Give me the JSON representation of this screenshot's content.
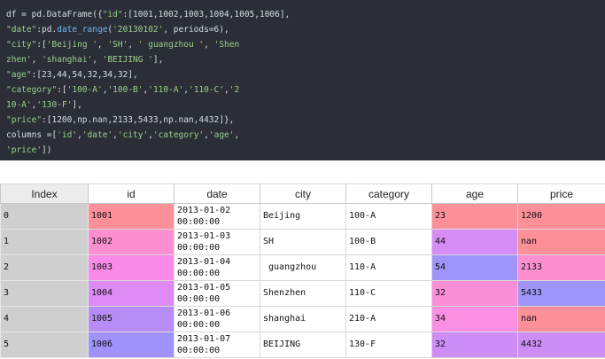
{
  "code": {
    "lines": [
      [
        {
          "t": "df = pd.DataFrame({",
          "c": ""
        },
        {
          "t": "\"id\"",
          "c": "str"
        },
        {
          "t": ":[1001,1002,1003,1004,1005,1006],",
          "c": ""
        }
      ],
      [
        {
          "t": "\"date\"",
          "c": "str"
        },
        {
          "t": ":pd.",
          "c": ""
        },
        {
          "t": "date_range",
          "c": "fn"
        },
        {
          "t": "(",
          "c": ""
        },
        {
          "t": "'20130102'",
          "c": "str"
        },
        {
          "t": ", periods=6),",
          "c": ""
        }
      ],
      [
        {
          "t": "\"city\"",
          "c": "str"
        },
        {
          "t": ":[",
          "c": ""
        },
        {
          "t": "'Beijing '",
          "c": "str"
        },
        {
          "t": ", ",
          "c": ""
        },
        {
          "t": "'SH'",
          "c": "str"
        },
        {
          "t": ", ",
          "c": ""
        },
        {
          "t": "' guangzhou '",
          "c": "str"
        },
        {
          "t": ", ",
          "c": ""
        },
        {
          "t": "'Shen",
          "c": "str"
        }
      ],
      [
        {
          "t": "zhen'",
          "c": "str"
        },
        {
          "t": ", ",
          "c": ""
        },
        {
          "t": "'shanghai'",
          "c": "str"
        },
        {
          "t": ", ",
          "c": ""
        },
        {
          "t": "'BEIJING '",
          "c": "str"
        },
        {
          "t": "],",
          "c": ""
        }
      ],
      [
        {
          "t": "\"age\"",
          "c": "str"
        },
        {
          "t": ":[23,44,54,32,34,32],",
          "c": ""
        }
      ],
      [
        {
          "t": "\"category\"",
          "c": "str"
        },
        {
          "t": ":[",
          "c": ""
        },
        {
          "t": "'100-A'",
          "c": "str"
        },
        {
          "t": ",",
          "c": ""
        },
        {
          "t": "'100-B'",
          "c": "str"
        },
        {
          "t": ",",
          "c": ""
        },
        {
          "t": "'110-A'",
          "c": "str"
        },
        {
          "t": ",",
          "c": ""
        },
        {
          "t": "'110-C'",
          "c": "str"
        },
        {
          "t": ",",
          "c": ""
        },
        {
          "t": "'2",
          "c": "str"
        }
      ],
      [
        {
          "t": "10-A'",
          "c": "str"
        },
        {
          "t": ",",
          "c": ""
        },
        {
          "t": "'130-F'",
          "c": "str"
        },
        {
          "t": "],",
          "c": ""
        }
      ],
      [
        {
          "t": "\"price\"",
          "c": "str"
        },
        {
          "t": ":[1200,np.nan,2133,5433,np.nan,4432]},",
          "c": ""
        }
      ],
      [
        {
          "t": "columns =[",
          "c": ""
        },
        {
          "t": "'id'",
          "c": "str"
        },
        {
          "t": ",",
          "c": ""
        },
        {
          "t": "'date'",
          "c": "str"
        },
        {
          "t": ",",
          "c": ""
        },
        {
          "t": "'city'",
          "c": "str"
        },
        {
          "t": ",",
          "c": ""
        },
        {
          "t": "'category'",
          "c": "str"
        },
        {
          "t": ",",
          "c": ""
        },
        {
          "t": "'age'",
          "c": "str"
        },
        {
          "t": ",",
          "c": ""
        }
      ],
      [
        {
          "t": "'price'",
          "c": "str"
        },
        {
          "t": "])",
          "c": ""
        }
      ]
    ]
  },
  "table": {
    "columns": [
      "Index",
      "id",
      "date",
      "city",
      "category",
      "age",
      "price"
    ],
    "rows": [
      {
        "index": "0",
        "id": "1001",
        "date": "2013-01-02\n00:00:00",
        "city": "Beijing",
        "category": "100-A",
        "age": "23",
        "price": "1200"
      },
      {
        "index": "1",
        "id": "1002",
        "date": "2013-01-03\n00:00:00",
        "city": "SH",
        "category": "100-B",
        "age": "44",
        "price": "nan"
      },
      {
        "index": "2",
        "id": "1003",
        "date": "2013-01-04\n00:00:00",
        "city": " guangzhou",
        "category": "110-A",
        "age": "54",
        "price": "2133"
      },
      {
        "index": "3",
        "id": "1004",
        "date": "2013-01-05\n00:00:00",
        "city": "Shenzhen",
        "category": "110-C",
        "age": "32",
        "price": "5433"
      },
      {
        "index": "4",
        "id": "1005",
        "date": "2013-01-06\n00:00:00",
        "city": "shanghai",
        "category": "210-A",
        "age": "34",
        "price": "nan"
      },
      {
        "index": "5",
        "id": "1006",
        "date": "2013-01-07\n00:00:00",
        "city": "BEIJING",
        "category": "130-F",
        "age": "32",
        "price": "4432"
      }
    ],
    "colors": {
      "id": [
        "#fd8f98",
        "#fb8fd0",
        "#f98ae8",
        "#dd8af4",
        "#b88cf6",
        "#9f93fb"
      ],
      "age": [
        "#fd8f98",
        "#d58cf4",
        "#9f94fa",
        "#fa8fd7",
        "#fa8fe3",
        "#ce8cf6"
      ],
      "price": [
        "#fd8f98",
        "#fd8f98",
        "#fb8fd0",
        "#9f94fa",
        "#fd8f98",
        "#ce8cf6"
      ]
    }
  }
}
